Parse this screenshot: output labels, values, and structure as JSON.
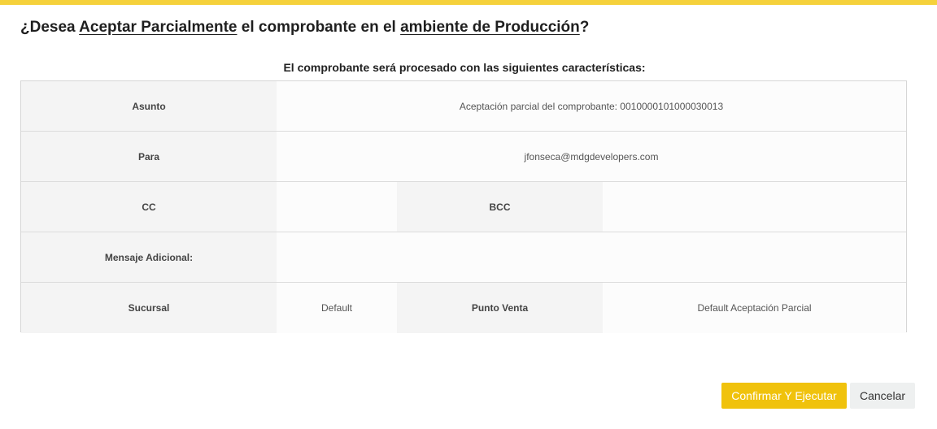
{
  "colors": {
    "accent": "#f5d13b",
    "confirm_button": "#f0c20c"
  },
  "dialog": {
    "title_prefix": "¿Desea ",
    "title_action": "Aceptar Parcialmente",
    "title_middle": " el comprobante en el ",
    "title_env": "ambiente de Producción",
    "title_suffix": "?",
    "subtitle": "El comprobante será procesado con las siguientes características:"
  },
  "table": {
    "asunto_label": "Asunto",
    "asunto_value": "Aceptación parcial del comprobante: 0010000101000030013",
    "para_label": "Para",
    "para_value": "jfonseca@mdgdevelopers.com",
    "cc_label": "CC",
    "cc_value": "",
    "bcc_label": "BCC",
    "bcc_value": "",
    "mensaje_label": "Mensaje Adicional:",
    "mensaje_value": "",
    "sucursal_label": "Sucursal",
    "sucursal_value": "Default",
    "punto_venta_label": "Punto Venta",
    "punto_venta_value": "Default Aceptación Parcial"
  },
  "buttons": {
    "confirm_label": "Confirmar Y Ejecutar",
    "cancel_label": "Cancelar"
  }
}
